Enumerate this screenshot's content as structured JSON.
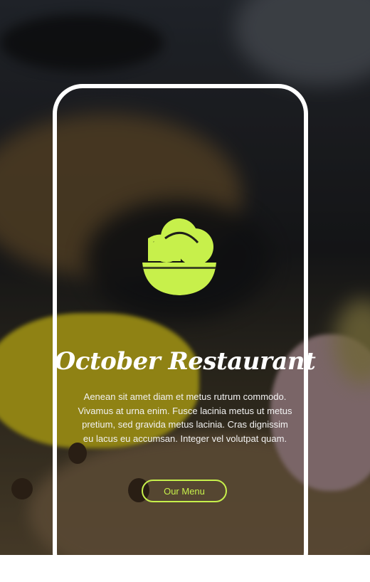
{
  "hero": {
    "title": "October Restaurant",
    "description": "Aenean sit amet diam et metus rutrum commodo. Vivamus at urna enim. Fusce lacinia metus ut metus pretium, sed gravida metus lacinia. Cras dignissim eu lacus eu accumsan. Integer vel volutpat quam.",
    "button_label": "Our Menu"
  },
  "logo": {
    "icon": "salad-bowl-icon"
  },
  "colors": {
    "accent": "#c7f04b",
    "frame": "#ffffff",
    "text": "#ffffff"
  }
}
